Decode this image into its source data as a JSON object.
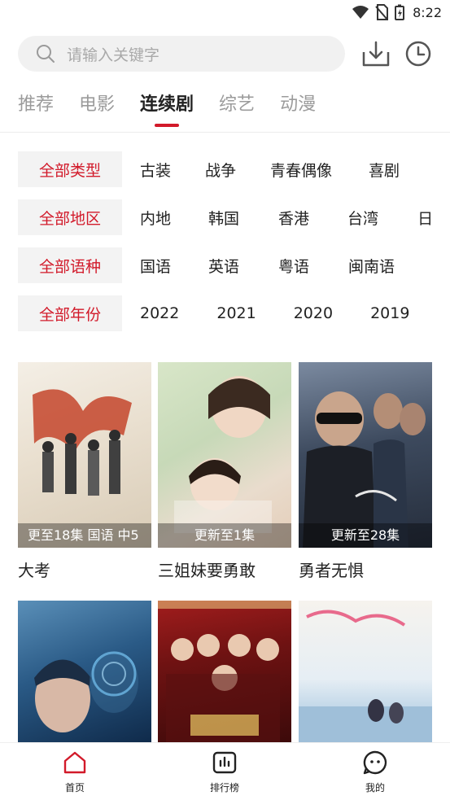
{
  "status_bar": {
    "time": "8:22"
  },
  "search": {
    "placeholder": "请输入关键字"
  },
  "tabs": [
    {
      "label": "推荐"
    },
    {
      "label": "电影"
    },
    {
      "label": "连续剧"
    },
    {
      "label": "综艺"
    },
    {
      "label": "动漫"
    }
  ],
  "active_tab": "连续剧",
  "filters": {
    "genre": {
      "selected": "全部类型",
      "options": [
        "古装",
        "战争",
        "青春偶像",
        "喜剧"
      ]
    },
    "region": {
      "selected": "全部地区",
      "options": [
        "内地",
        "韩国",
        "香港",
        "台湾",
        "日"
      ]
    },
    "language": {
      "selected": "全部语种",
      "options": [
        "国语",
        "英语",
        "粤语",
        "闽南语"
      ]
    },
    "year": {
      "selected": "全部年份",
      "options": [
        "2022",
        "2021",
        "2020",
        "2019"
      ]
    }
  },
  "shows": [
    {
      "title": "大考",
      "caption": "更至18集 国语 中5"
    },
    {
      "title": "三姐妹要勇敢",
      "caption": "更新至1集"
    },
    {
      "title": "勇者无惧",
      "caption": "更新至28集"
    },
    {
      "title": "",
      "caption": ""
    },
    {
      "title": "",
      "caption": ""
    },
    {
      "title": "",
      "caption": ""
    }
  ],
  "bottom_nav": [
    {
      "label": "首页"
    },
    {
      "label": "排行榜"
    },
    {
      "label": "我的"
    }
  ],
  "colors": {
    "accent": "#d21a2a",
    "muted_text": "#9b9b9b",
    "chip_bg": "#f3f3f3"
  }
}
